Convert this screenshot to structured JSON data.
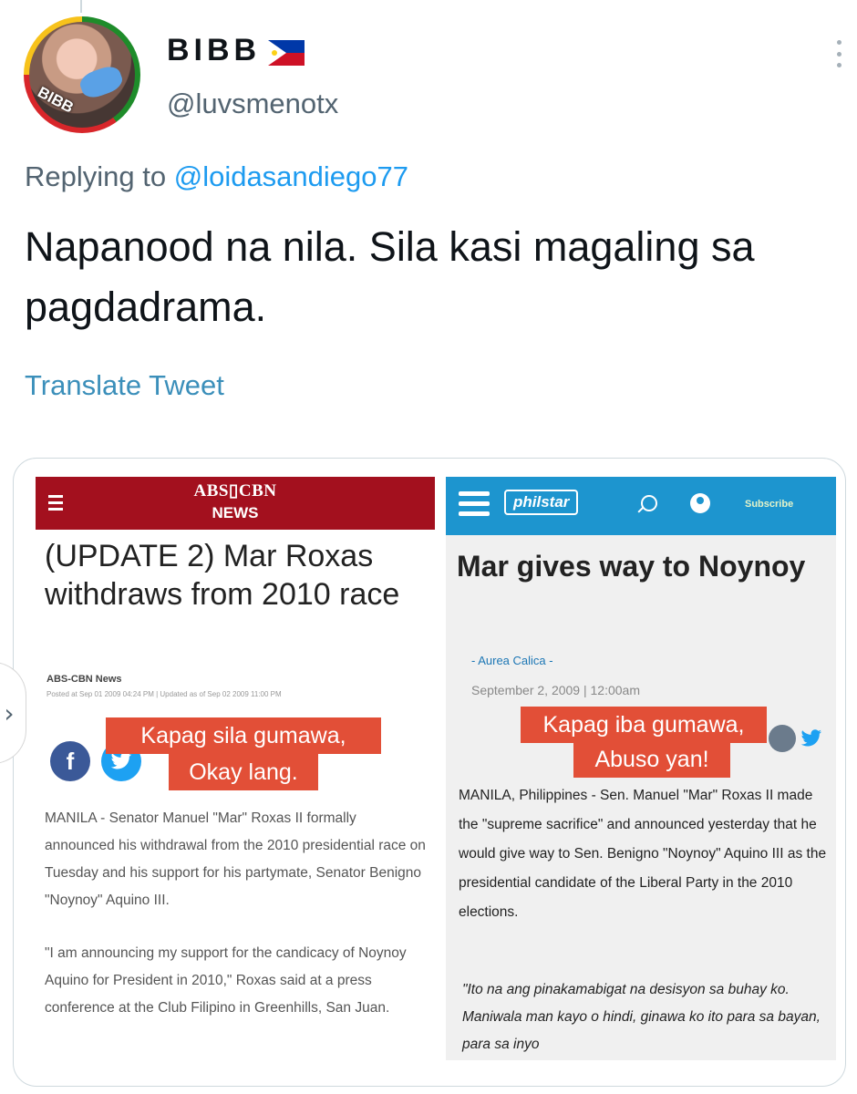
{
  "tweet": {
    "display_name": "BIBB",
    "handle": "@luvsmenotx",
    "avatar_text": "BIBB",
    "replying_prefix": "Replying to",
    "replying_to": "@loidasandiego77",
    "text": "Napanood na nila. Sila kasi magaling sa pagdadrama.",
    "translate_label": "Translate Tweet"
  },
  "left_article": {
    "logo": "ABS▯CBN",
    "logo_sub": "NEWS",
    "title": "(UPDATE 2) Mar Roxas withdraws from 2010 race",
    "byline": "ABS-CBN News",
    "dateline": "Posted at Sep 01 2009 04:24 PM | Updated as of Sep 02 2009 11:00 PM",
    "callout_line1": "Kapag sila gumawa,",
    "callout_line2": "Okay lang.",
    "paragraph1": "MANILA - Senator Manuel \"Mar\" Roxas II formally announced his withdrawal from the 2010 presidential race on Tuesday and his support for his partymate, Senator Benigno \"Noynoy\" Aquino III.",
    "paragraph2": "\"I am announcing my support for the candicacy of Noynoy Aquino for President in 2010,\" Roxas said at a press conference at the Club Filipino in Greenhills, San Juan."
  },
  "right_article": {
    "logo": "philstar",
    "subscribe_label": "Subscribe",
    "title": "Mar gives way to Noynoy",
    "author": "- Aurea Calica -",
    "pubdate": "September 2, 2009 | 12:00am",
    "callout_line1": "Kapag iba gumawa,",
    "callout_line2": "Abuso yan!",
    "paragraph1": "MANILA, Philippines - Sen. Manuel \"Mar\" Roxas II made the \"supreme sacrifice\" and announced yesterday that he would give way to Sen. Benigno \"Noynoy\" Aquino III as the presidential candidate of the Liberal Party in the 2010 elections.",
    "paragraph2": "\"Ito na ang pinakamabigat na desisyon sa buhay ko. Maniwala man kayo o hindi, ginawa ko ito para sa bayan, para sa inyo"
  },
  "icons": {
    "more": "more-vertical-icon",
    "flag": "philippines-flag-icon",
    "prev": "chevron-left-icon",
    "facebook": "f",
    "twitter": "twitter-icon"
  },
  "colors": {
    "abs_red": "#a3101e",
    "philstar_blue": "#1d95cf",
    "callout_red": "#e24f37",
    "link_blue": "#1d9bf0",
    "translate_blue": "#3b8fba"
  }
}
